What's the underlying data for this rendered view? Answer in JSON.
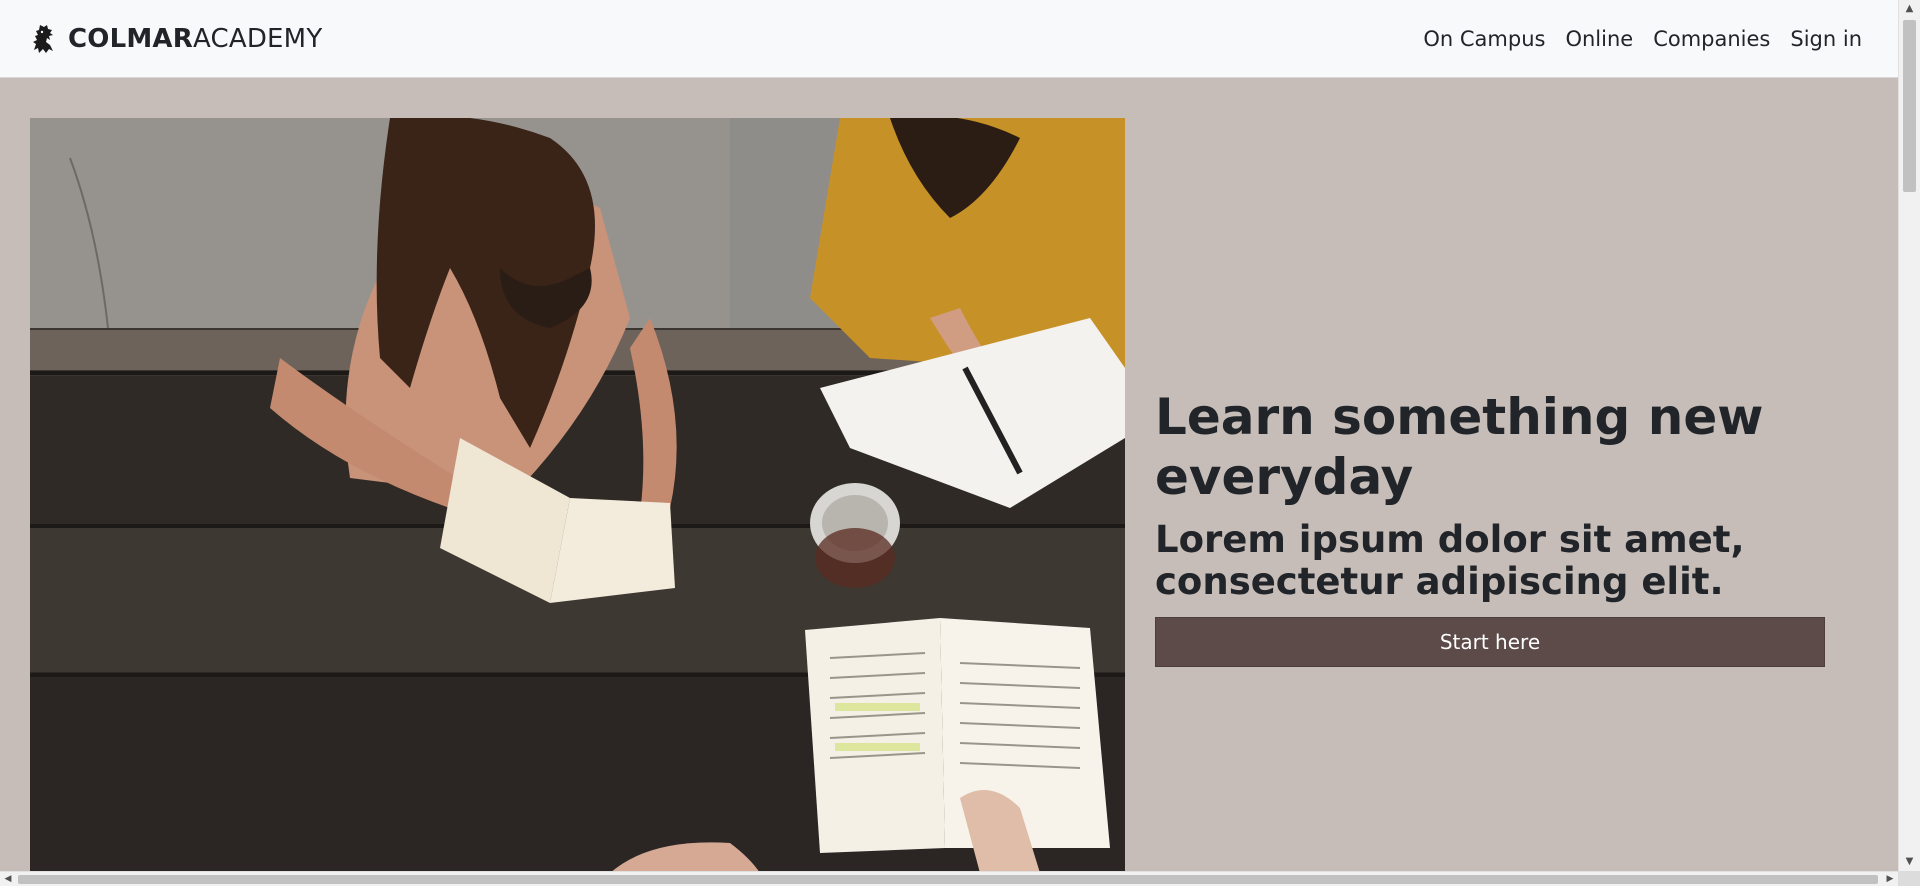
{
  "navbar": {
    "brand": {
      "bold": "COLMAR",
      "light": "ACADEMY",
      "logo_icon": "lion-rampant-icon"
    },
    "links": [
      {
        "label": "On Campus"
      },
      {
        "label": "Online"
      },
      {
        "label": "Companies"
      },
      {
        "label": "Sign in"
      }
    ]
  },
  "hero": {
    "image_alt": "Students reading and writing at a wooden picnic table",
    "title": "Learn something new everyday",
    "subtitle": "Lorem ipsum dolor sit amet, consectetur adipiscing elit.",
    "cta_label": "Start here"
  },
  "colors": {
    "page_background": "#c6bcb8",
    "navbar_background": "#f8f9fa",
    "button_background": "#5c4b49",
    "text": "#212529"
  }
}
